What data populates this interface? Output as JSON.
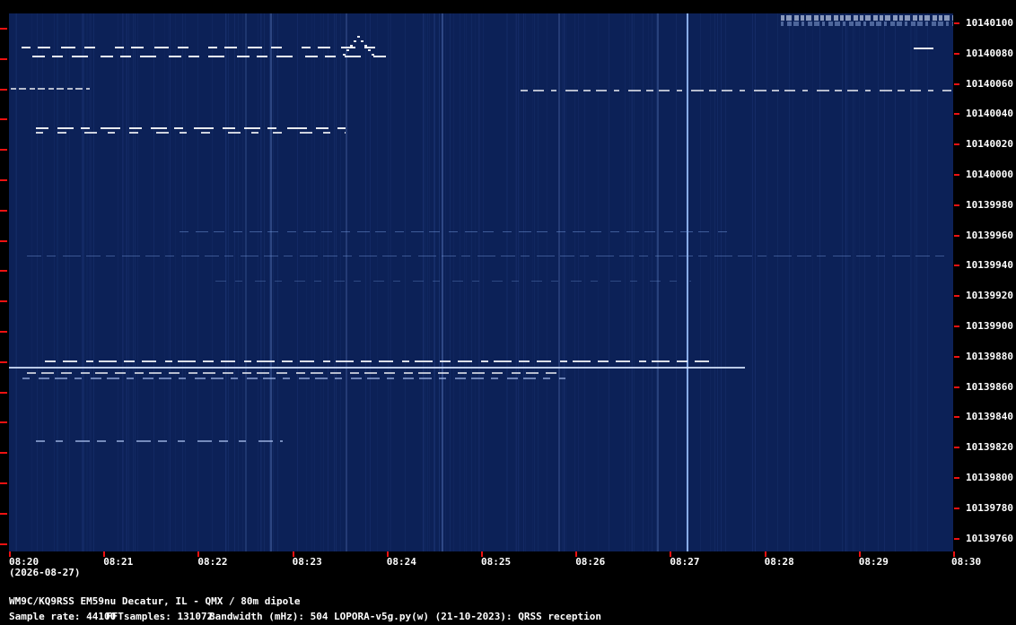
{
  "y_axis": {
    "labels": [
      "10140100",
      "10140080",
      "10140060",
      "10140040",
      "10140020",
      "10140000",
      "10139980",
      "10139960",
      "10139940",
      "10139920",
      "10139900",
      "10139880",
      "10139860",
      "10139840",
      "10139820",
      "10139800",
      "10139780",
      "10139760"
    ]
  },
  "x_axis": {
    "labels": [
      "08:20",
      "08:21",
      "08:22",
      "08:23",
      "08:24",
      "08:25",
      "08:26",
      "08:27",
      "08:28",
      "08:29",
      "08:30"
    ],
    "date": "(2026-08-27)"
  },
  "footer": {
    "station": "WM9C/KQ9RSS EM59nu Decatur, IL - QMX / 80m dipole",
    "sample_rate": "Sample rate: 44100",
    "fft_samples": "FFTsamples: 131072",
    "bandwidth": "Bandwidth (mHz): 504",
    "software": "LOPORA-v5g.py(w) (21-10-2023): QRSS reception"
  },
  "colors": {
    "background": "#000000",
    "waterfall": "#0c2157",
    "signal": "#ffffff",
    "tick": "#ee1111"
  }
}
